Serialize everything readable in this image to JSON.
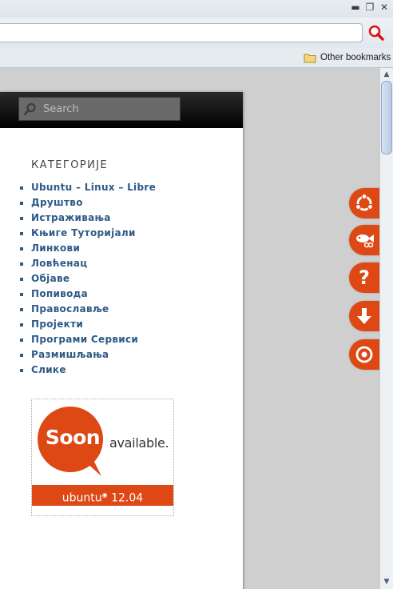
{
  "browser": {
    "window_controls": [
      "minimize",
      "restore",
      "close"
    ],
    "bookmarks_bar": {
      "other_bookmarks_label": "Other bookmarks"
    }
  },
  "page": {
    "search": {
      "placeholder": "Search"
    },
    "categories_widget": {
      "title": "КАТЕГОРИЈЕ",
      "items": [
        "Ubuntu – Linux – Libre",
        "Друштво",
        "Истраживања",
        "Књиге Туторијали",
        "Линкови",
        "Ловћенац",
        "Објаве",
        "Попивода",
        "Православље",
        "Пројекти",
        "Програми Сервиси",
        "Размишљања",
        "Слике"
      ]
    },
    "banner": {
      "soon": "Soon",
      "available": "available.",
      "brand": "ubuntu",
      "version": "12.04"
    },
    "side_buttons": [
      "ubuntu-logo-icon",
      "fish-icon",
      "question-icon",
      "download-arrow-icon",
      "target-icon"
    ],
    "accent_color": "#dd4814",
    "link_color": "#2d5a86"
  }
}
